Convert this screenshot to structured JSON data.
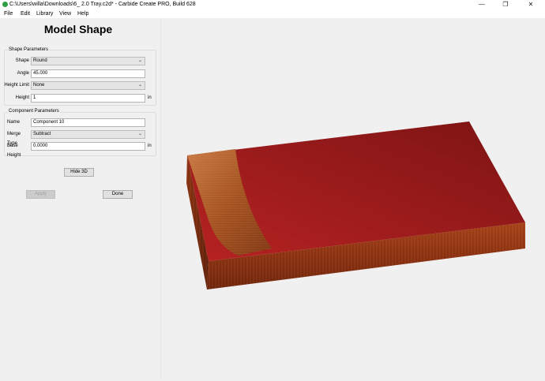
{
  "window": {
    "title": "C:\\Users\\willa\\Downloads\\6_ 2.0 Tray.c2d* - Carbide Create PRO, Build 628",
    "minimize_glyph": "—",
    "maximize_glyph": "❐",
    "close_glyph": "✕"
  },
  "menu": {
    "items": [
      "File",
      "Edit",
      "Library",
      "View",
      "Help"
    ]
  },
  "panel": {
    "heading": "Model Shape",
    "shape_parameters": {
      "title": "Shape Parameters",
      "shape": {
        "label": "Shape",
        "value": "Round"
      },
      "angle": {
        "label": "Angle",
        "value": "45.000"
      },
      "height_limit": {
        "label": "Height Limit",
        "value": "None"
      },
      "height": {
        "label": "Height",
        "value": "1",
        "unit": "in"
      }
    },
    "component_parameters": {
      "title": "Component Parameters",
      "name": {
        "label": "Name",
        "value": "Component 10"
      },
      "merge_type": {
        "label": "Merge Type",
        "value": "Subtract"
      },
      "base_height": {
        "label": "Base Height",
        "value": "0.0000",
        "unit": "in"
      }
    },
    "buttons": {
      "hide3d": "Hide 3D",
      "apply": "Apply",
      "done": "Done"
    }
  },
  "colors": {
    "top_face": "#a81c1c",
    "front_face": "#8e3312",
    "side_face": "#7a2a10"
  }
}
